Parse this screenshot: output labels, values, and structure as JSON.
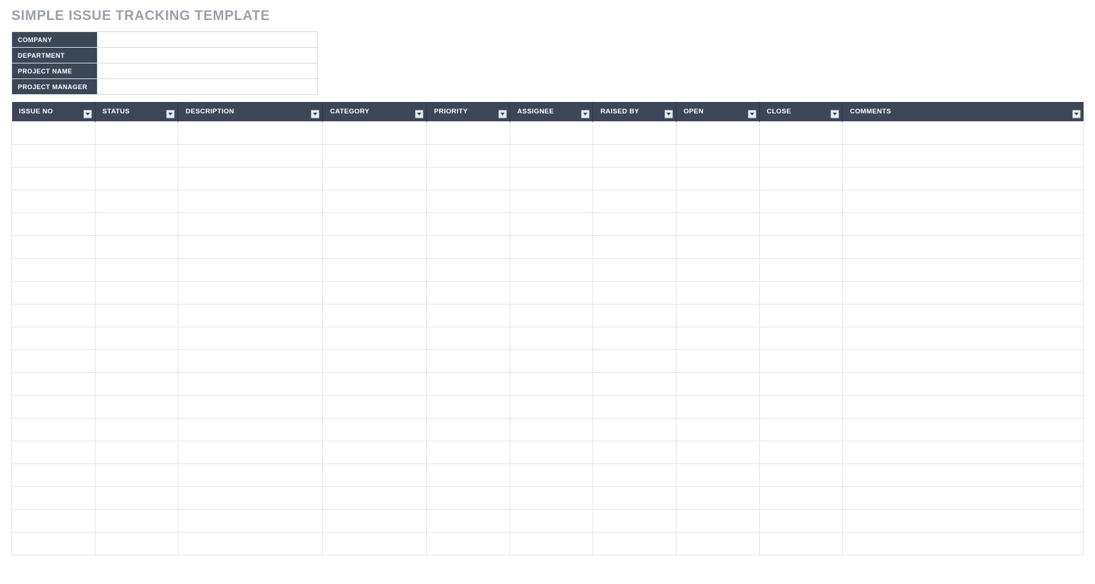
{
  "title": "SIMPLE ISSUE TRACKING TEMPLATE",
  "info": {
    "company_label": "COMPANY",
    "company_value": "",
    "department_label": "DEPARTMENT",
    "department_value": "",
    "project_name_label": "PROJECT NAME",
    "project_name_value": "",
    "project_manager_label": "PROJECT MANAGER",
    "project_manager_value": ""
  },
  "columns": {
    "issue_no": "ISSUE NO",
    "status": "STATUS",
    "description": "DESCRIPTION",
    "category": "CATEGORY",
    "priority": "PRIORITY",
    "assignee": "ASSIGNEE",
    "raised_by": "RAISED BY",
    "open": "OPEN",
    "close": "CLOSE",
    "comments": "COMMENTS"
  },
  "row_count": 19
}
